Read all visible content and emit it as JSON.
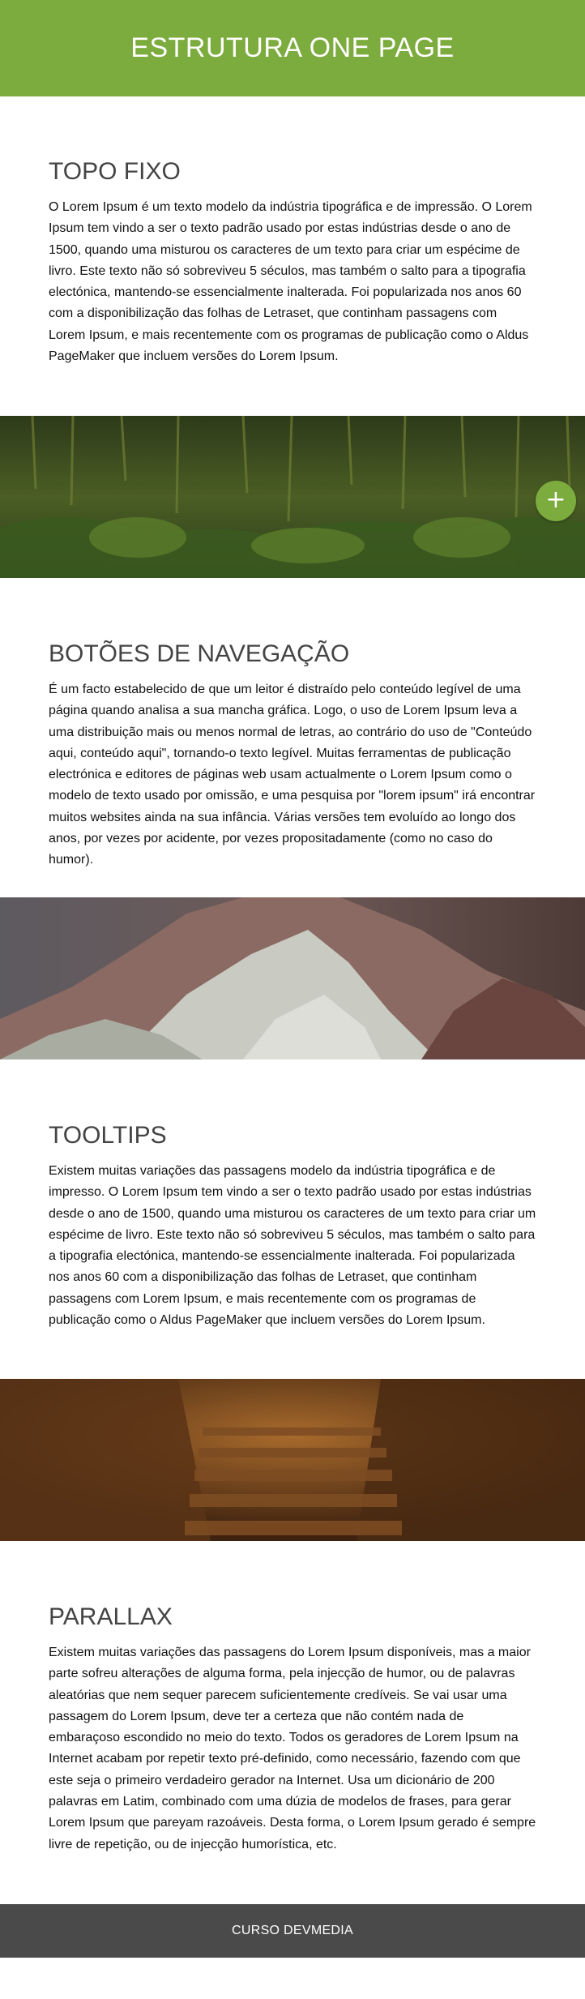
{
  "header": {
    "title": "ESTRUTURA ONE PAGE"
  },
  "sections": [
    {
      "title": "TOPO FIXO",
      "text": "O Lorem Ipsum é um texto modelo da indústria tipográfica e de impressão. O Lorem Ipsum tem vindo a ser o texto padrão usado por estas indústrias desde o ano de 1500, quando uma misturou os caracteres de um texto para criar um espécime de livro. Este texto não só sobreviveu 5 séculos, mas também o salto para a tipografia electónica, mantendo-se essencialmente inalterada. Foi popularizada nos anos 60 com a disponibilização das folhas de Letraset, que continham passagens com Lorem Ipsum, e mais recentemente com os programas de publicação como o Aldus PageMaker que incluem versões do Lorem Ipsum."
    },
    {
      "title": "BOTÕES DE NAVEGAÇÃO",
      "text": "É um facto estabelecido de que um leitor é distraído pelo conteúdo legível de uma página quando analisa a sua mancha gráfica. Logo, o uso de Lorem Ipsum leva a uma distribuição mais ou menos normal de letras, ao contrário do uso de \"Conteúdo aqui, conteúdo aqui\", tornando-o texto legível. Muitas ferramentas de publicação electrónica e editores de páginas web usam actualmente o Lorem Ipsum como o modelo de texto usado por omissão, e uma pesquisa por \"lorem ipsum\" irá encontrar muitos websites ainda na sua infância. Várias versões tem evoluído ao longo dos anos, por vezes por acidente, por vezes propositadamente (como no caso do humor)."
    },
    {
      "title": "TOOLTIPS",
      "text": "Existem muitas variações das passagens modelo da indústria tipográfica e de impresso. O Lorem Ipsum tem vindo a ser o texto padrão usado por estas indústrias desde o ano de 1500, quando uma misturou os caracteres de um texto para criar um espécime de livro. Este texto não só sobreviveu 5 séculos, mas também o salto para a tipografia electónica, mantendo-se essencialmente inalterada. Foi popularizada nos anos 60 com a disponibilização das folhas de Letraset, que continham passagens com Lorem Ipsum, e mais recentemente com os programas de publicação como o Aldus PageMaker que incluem versões do Lorem Ipsum."
    },
    {
      "title": "PARALLAX",
      "text": "Existem muitas variações das passagens do Lorem Ipsum disponíveis, mas a maior parte sofreu alterações de alguma forma, pela injecção de humor, ou de palavras aleatórias que nem sequer parecem suficientemente credíveis. Se vai usar uma passagem do Lorem Ipsum, deve ter a certeza que não contém nada de embaraçoso escondido no meio do texto. Todos os geradores de Lorem Ipsum na Internet acabam por repetir texto pré-definido, como necessário, fazendo com que este seja o primeiro verdadeiro gerador na Internet. Usa um dicionário de 200 palavras em Latim, combinado com uma dúzia de modelos de frases, para gerar Lorem Ipsum que pareyam razoáveis. Desta forma, o Lorem Ipsum gerado é sempre livre de repetição, ou de injecção humorística, etc."
    }
  ],
  "fab": {
    "label": "+"
  },
  "footer": {
    "text": "CURSO DEVMEDIA"
  },
  "colors": {
    "accent": "#7cab3e",
    "footer": "#4a4a4a"
  },
  "images": [
    {
      "name": "forest-banner"
    },
    {
      "name": "mountain-banner"
    },
    {
      "name": "stairs-banner"
    }
  ]
}
